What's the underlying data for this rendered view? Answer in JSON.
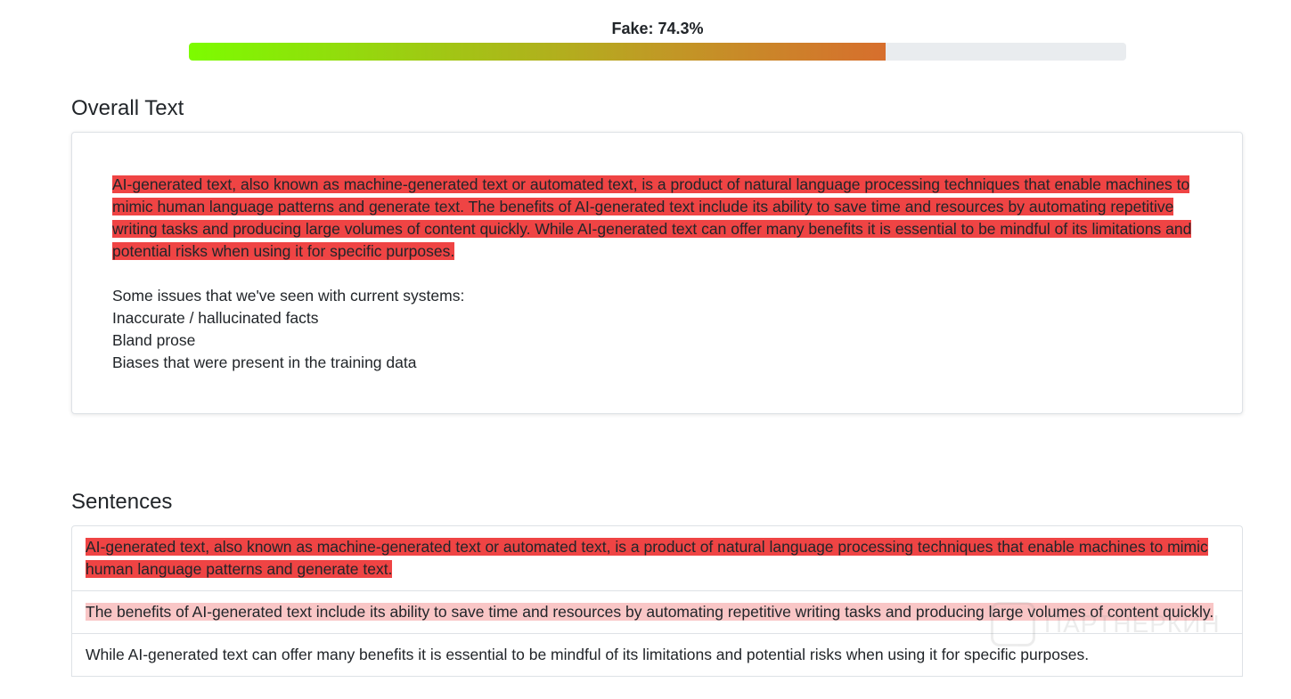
{
  "score": {
    "label": "Fake: 74.3%",
    "fake_fraction": 0.743,
    "gradient_colors": [
      "#7cfc00",
      "#c09a25",
      "#ef4036"
    ],
    "track_color": "#e9ecef"
  },
  "overall": {
    "title": "Overall Text",
    "highlighted_text": "AI-generated text, also known as machine-generated text or automated text, is a product of natural language processing techniques that enable machines to mimic human language patterns and generate text. The benefits of AI-generated text include its ability to save time and resources by automating repetitive writing tasks and producing large volumes of content quickly. While AI-generated text can offer many benefits it is essential to be mindful of its limitations and potential risks when using it for specific purposes.",
    "highlight_color": "#ef4444",
    "issues_lines": [
      "Some issues that we've seen with current systems:",
      "Inaccurate / hallucinated facts",
      "Bland prose",
      "Biases that were present in the training data"
    ]
  },
  "sentences": {
    "title": "Sentences",
    "items": [
      {
        "text": "AI-generated text, also known as machine-generated text or automated text, is a product of natural language processing techniques that enable machines to mimic human language patterns and generate text.",
        "highlight": "strong",
        "color": "#ef4444"
      },
      {
        "text": "The benefits of AI-generated text include its ability to save time and resources by automating repetitive writing tasks and producing large volumes of content quickly.",
        "highlight": "light",
        "color": "#f9c6c6"
      },
      {
        "text": "While AI-generated text can offer many benefits it is essential to be mindful of its limitations and potential risks when using it for specific purposes.",
        "highlight": "none",
        "color": "#ffffff"
      }
    ]
  },
  "watermark": {
    "text": "ПАРТНЕРКИН"
  }
}
